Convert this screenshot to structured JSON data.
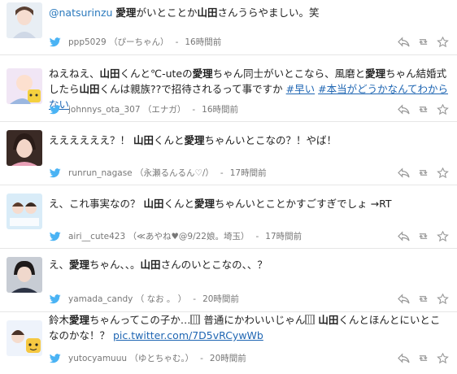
{
  "tweets": [
    {
      "segments": [
        {
          "t": "@natsurinzu",
          "c": "uname"
        },
        {
          "t": " "
        },
        {
          "t": "愛理",
          "c": "kw"
        },
        {
          "t": "がいとことか"
        },
        {
          "t": "山田",
          "c": "kw"
        },
        {
          "t": "さんうらやましい。笑"
        }
      ],
      "handle": "ppp5029",
      "display": "（ぴーちゃん）",
      "time": "16時間前"
    },
    {
      "segments": [
        {
          "t": "ねえねえ、"
        },
        {
          "t": "山田",
          "c": "kw"
        },
        {
          "t": "くんと℃-uteの"
        },
        {
          "t": "愛理",
          "c": "kw"
        },
        {
          "t": "ちゃん同士がいとこなら、風磨と"
        },
        {
          "t": "愛理",
          "c": "kw"
        },
        {
          "t": "ちゃん結婚式したら"
        },
        {
          "t": "山田",
          "c": "kw"
        },
        {
          "t": "くんは親族??で招待されるって事ですか "
        },
        {
          "t": "#早い",
          "c": "tag"
        },
        {
          "t": " "
        },
        {
          "t": "#本当がどうかなんてわからない",
          "c": "tag"
        }
      ],
      "handle": "johnnys_ota_307",
      "display": "（エナガ）",
      "time": "16時間前"
    },
    {
      "segments": [
        {
          "t": "ええええええ？！ "
        },
        {
          "t": "山田",
          "c": "kw"
        },
        {
          "t": "くんと"
        },
        {
          "t": "愛理",
          "c": "kw"
        },
        {
          "t": "ちゃんいとこなの？！やば！"
        }
      ],
      "handle": "runrun_nagase",
      "display": "（永瀬るんるん♡/）",
      "time": "17時間前"
    },
    {
      "segments": [
        {
          "t": "え、これ事実なの？ "
        },
        {
          "t": "山田",
          "c": "kw"
        },
        {
          "t": "くんと"
        },
        {
          "t": "愛理",
          "c": "kw"
        },
        {
          "t": "ちゃんいとことかすごすぎでしょ →RT"
        }
      ],
      "handle": "airi__cute423",
      "display": "（≪あやね♥@9/22娘。埼玉）",
      "time": "17時間前"
    },
    {
      "segments": [
        {
          "t": "え、"
        },
        {
          "t": "愛理",
          "c": "kw"
        },
        {
          "t": "ちゃん、、。"
        },
        {
          "t": "山田",
          "c": "kw"
        },
        {
          "t": "さんのいとこなの、、？"
        }
      ],
      "handle": "yamada_candy",
      "display": "（ なお 。 ）",
      "time": "20時間前"
    },
    {
      "segments": [
        {
          "t": "鈴木"
        },
        {
          "t": "愛理",
          "c": "kw"
        },
        {
          "t": "ちゃんってこの子か…"
        },
        {
          "t": "■",
          "c": "box"
        },
        {
          "t": " 普通にかわいいじゃん"
        },
        {
          "t": "■",
          "c": "box"
        },
        {
          "t": " "
        },
        {
          "t": "山田",
          "c": "kw"
        },
        {
          "t": "くんとほんとにいとこなのかな！？ "
        },
        {
          "t": "pic.twitter.com/7D5vRCywWb",
          "c": "link"
        }
      ],
      "handle": "yutocyamuuu",
      "display": "（ゆとちゃむ。）",
      "time": "20時間前"
    }
  ],
  "icons": {
    "service": "twitter-bird-icon",
    "reply": "reply-icon",
    "retweet": "retweet-icon",
    "favorite": "favorite-star-icon"
  },
  "colors": {
    "link": "#1f66b3",
    "bird": "#4ab3f4",
    "meta": "#777777",
    "divider": "#e6e6e6"
  }
}
